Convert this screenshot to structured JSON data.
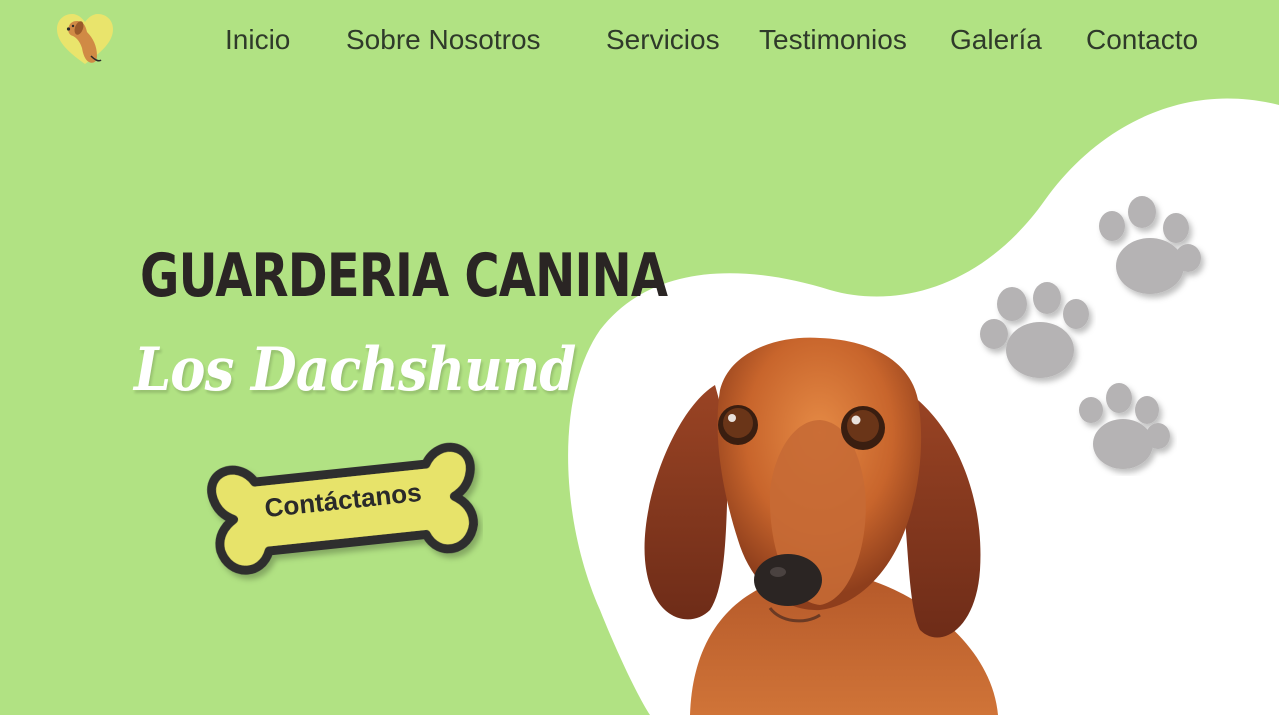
{
  "header": {
    "logo_icon": "dachshund-heart-logo",
    "nav": [
      {
        "label": "Inicio"
      },
      {
        "label": "Sobre Nosotros"
      },
      {
        "label": "Servicios"
      },
      {
        "label": "Testimonios"
      },
      {
        "label": "Galería"
      },
      {
        "label": "Contacto"
      }
    ]
  },
  "hero": {
    "title": "GUARDERIA CANINA",
    "subtitle": "Los Dachshund",
    "cta_label": "Contáctanos",
    "cta_icon": "bone-shape",
    "decor_icons": [
      "paw-print-icon",
      "paw-print-icon",
      "paw-print-icon"
    ],
    "image": "dachshund-dog-photo"
  },
  "colors": {
    "background": "#b1e283",
    "blob": "#ffffff",
    "title": "#2a2524",
    "subtitle": "#ffffff",
    "bone_fill": "#e7e36a",
    "bone_outline": "#2e2e2e",
    "paw": "#b5b3b4",
    "nav_text": "#2f3a2a"
  }
}
